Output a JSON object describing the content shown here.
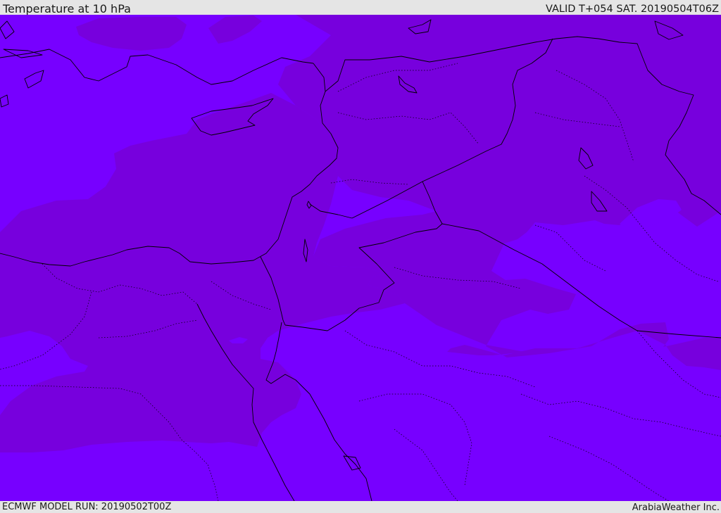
{
  "header": {
    "title": "Temperature at 10 hPa",
    "valid_time": "VALID T+054 SAT. 20190504T06Z"
  },
  "footer": {
    "model_run": "ECMWF MODEL RUN: 20190502T00Z",
    "credit": "ArabiaWeather Inc."
  },
  "colors": {
    "band_warm": "#7700dd",
    "band_cold": "#7700ff",
    "background_bar": "#e5e5e5",
    "coastline": "#000000"
  }
}
